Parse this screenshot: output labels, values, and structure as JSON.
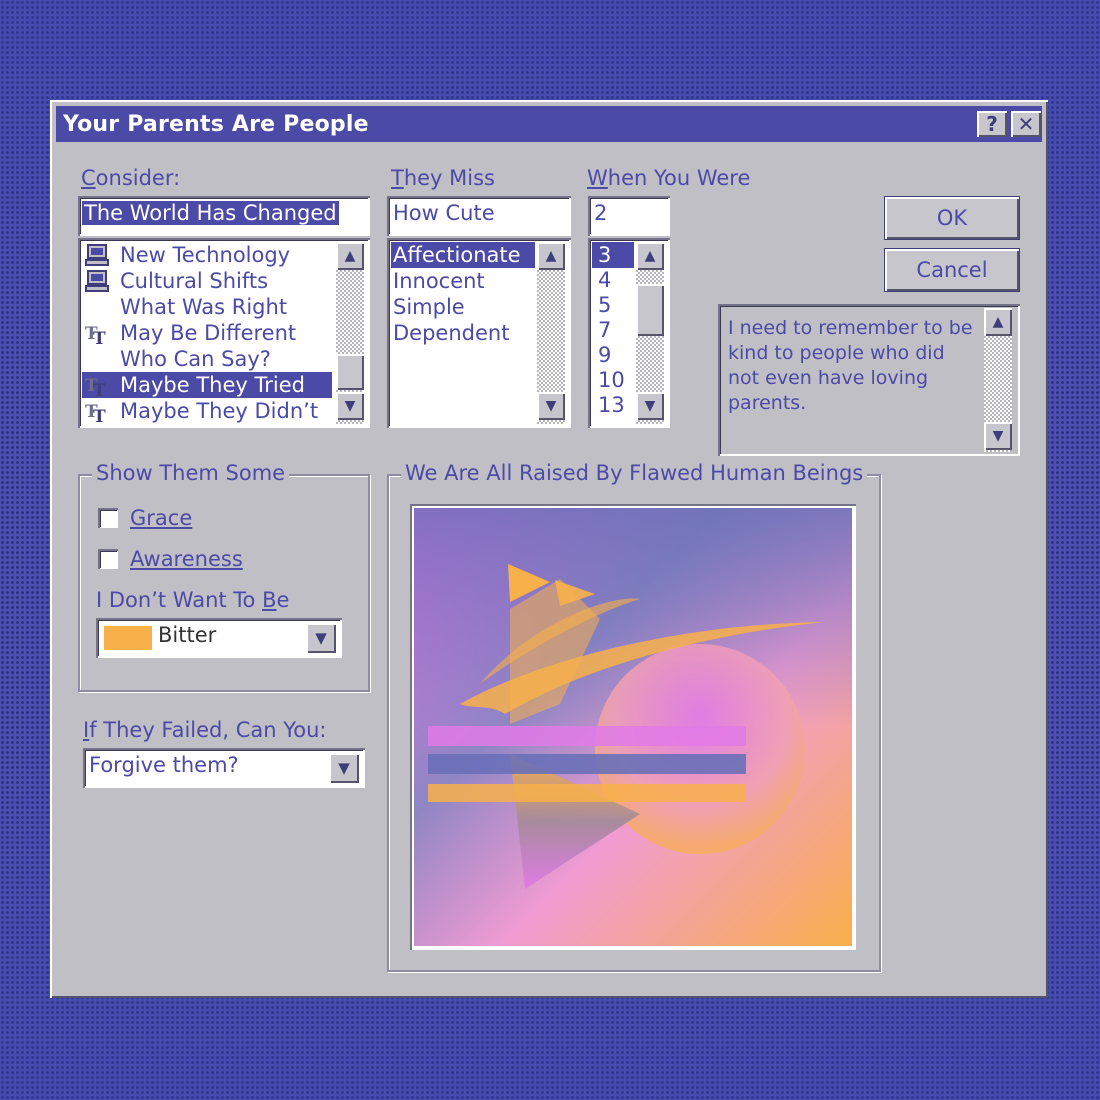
{
  "window": {
    "title": "Your Parents Are People",
    "help_button": "?",
    "close_button": "✕"
  },
  "consider": {
    "label_mnemonic": "C",
    "label_rest": "onsider:",
    "input_value": "The World Has Changed",
    "items": [
      {
        "label": "New Technology",
        "icon": "computer-icon"
      },
      {
        "label": "Cultural Shifts",
        "icon": "computer-icon"
      },
      {
        "label": "What Was Right",
        "icon": ""
      },
      {
        "label": "May Be Different",
        "icon": "font-tt-icon"
      },
      {
        "label": "Who Can Say?",
        "icon": ""
      },
      {
        "label": "Maybe They Tried",
        "icon": "font-tt-icon",
        "selected": true
      },
      {
        "label": "Maybe They Didn’t",
        "icon": "font-tt-icon"
      }
    ]
  },
  "they_miss": {
    "label_mnemonic": "T",
    "label_rest": "hey Miss",
    "input_value": "How Cute",
    "items": [
      "Affectionate",
      "Innocent",
      "Simple",
      "Dependent"
    ],
    "selected_index": 0
  },
  "when_you_were": {
    "label_mnemonic": "W",
    "label_rest": "hen You Were",
    "input_value": "2",
    "items": [
      "3",
      "4",
      "5",
      "7",
      "9",
      "10",
      "13"
    ],
    "selected_index": 0
  },
  "buttons": {
    "ok": "OK",
    "cancel": "Cancel"
  },
  "note": {
    "text_lines": [
      "I need to remember to be",
      "kind to people who did",
      "not even have loving",
      "parents."
    ]
  },
  "show_them_some": {
    "title": "Show Them Some",
    "grace_mnemonic": "G",
    "grace_rest": "race",
    "grace_checked": false,
    "awareness_mnemonic": "A",
    "awareness_rest": "wareness",
    "awareness_checked": false,
    "dont_want_prefix": "I Don’t Want To ",
    "dont_want_mnemonic": "B",
    "dont_want_suffix": "e",
    "color_value": "Bitter",
    "swatch_color": "#f8b04a"
  },
  "if_failed": {
    "label_mnemonic": "I",
    "label_rest": "f They Failed, Can You:",
    "value": "Forgive them?"
  },
  "image_group": {
    "title": "We Are All Raised By Flawed Human Beings"
  },
  "colors": {
    "accent": "#4b4aa6",
    "face": "#c0bfc6",
    "orange": "#f8b04a",
    "pink": "#e07ae6"
  }
}
